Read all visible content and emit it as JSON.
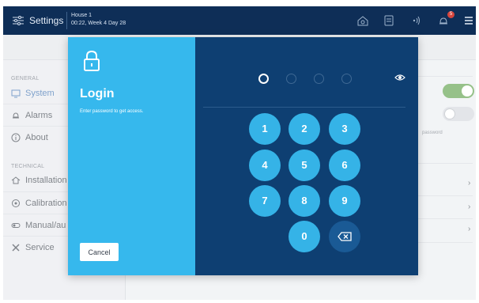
{
  "topbar": {
    "title": "Settings",
    "house_name": "House 1",
    "house_time": "00:22, Week 4 Day 28",
    "notification_count": "5"
  },
  "sidebar": {
    "general_label": "GENERAL",
    "technical_label": "TECHNICAL",
    "items": [
      {
        "label": "System",
        "icon": "monitor-icon"
      },
      {
        "label": "Alarms",
        "icon": "bell-icon"
      },
      {
        "label": "About",
        "icon": "info-icon"
      },
      {
        "label": "Installation",
        "icon": "house-icon"
      },
      {
        "label": "Calibration",
        "icon": "target-icon"
      },
      {
        "label": "Manual/au",
        "icon": "toggle-icon"
      },
      {
        "label": "Service",
        "icon": "tools-icon"
      }
    ]
  },
  "content": {
    "password_text": "password",
    "chevron": "›"
  },
  "login": {
    "title": "Login",
    "subtitle": "Enter password to get access.",
    "cancel_label": "Cancel",
    "keys": [
      "1",
      "2",
      "3",
      "4",
      "5",
      "6",
      "7",
      "8",
      "9",
      "0"
    ],
    "pin_length": 4,
    "entered_digits": 1
  },
  "colors": {
    "topbar": "#0e2e57",
    "login_panel": "#36b8ed",
    "keypad_panel": "#0e3f72",
    "key": "#35b3e7",
    "toggle_on": "#5fa04a"
  }
}
